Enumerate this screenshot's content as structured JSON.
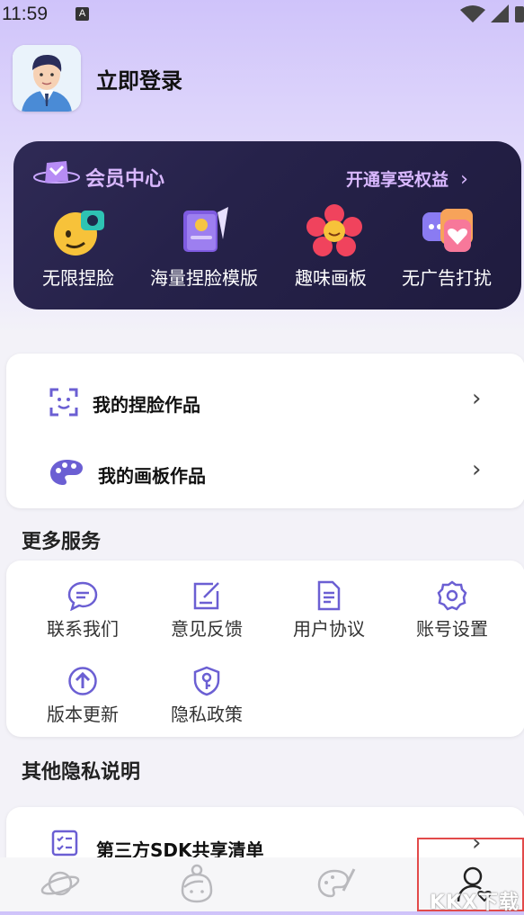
{
  "status_bar": {
    "time": "11:59",
    "notification_badge": "A"
  },
  "profile": {
    "login_label": "立即登录"
  },
  "member": {
    "title": "会员中心",
    "cta": "开通享受权益",
    "perks": [
      {
        "label": "无限捏脸",
        "icon": "emoji-face-icon"
      },
      {
        "label": "海量捏脸模版",
        "icon": "template-book-icon"
      },
      {
        "label": "趣味画板",
        "icon": "flower-icon"
      },
      {
        "label": "无广告打扰",
        "icon": "no-ads-heart-icon"
      }
    ]
  },
  "my_works": [
    {
      "label": "我的捏脸作品",
      "icon": "face-scan-icon"
    },
    {
      "label": "我的画板作品",
      "icon": "palette-icon"
    }
  ],
  "more_services": {
    "title": "更多服务",
    "items": [
      {
        "label": "联系我们",
        "icon": "chat-bubble-icon"
      },
      {
        "label": "意见反馈",
        "icon": "edit-feedback-icon"
      },
      {
        "label": "用户协议",
        "icon": "document-icon"
      },
      {
        "label": "账号设置",
        "icon": "gear-icon"
      },
      {
        "label": "版本更新",
        "icon": "upload-arrow-icon"
      },
      {
        "label": "隐私政策",
        "icon": "shield-key-icon"
      }
    ]
  },
  "other_privacy": {
    "title": "其他隐私说明",
    "items": [
      {
        "label": "第三方SDK共享清单",
        "icon": "checklist-icon"
      }
    ]
  },
  "bottom_nav": [
    {
      "icon": "planet-icon"
    },
    {
      "icon": "girl-face-icon"
    },
    {
      "icon": "paint-palette-icon"
    },
    {
      "icon": "profile-icon"
    }
  ],
  "watermark": "KKX下载",
  "colors": {
    "accent": "#6b5fd3",
    "card_dark": "#26224a",
    "member_text": "#d9b8ff",
    "highlight_border": "#e24a4a"
  }
}
